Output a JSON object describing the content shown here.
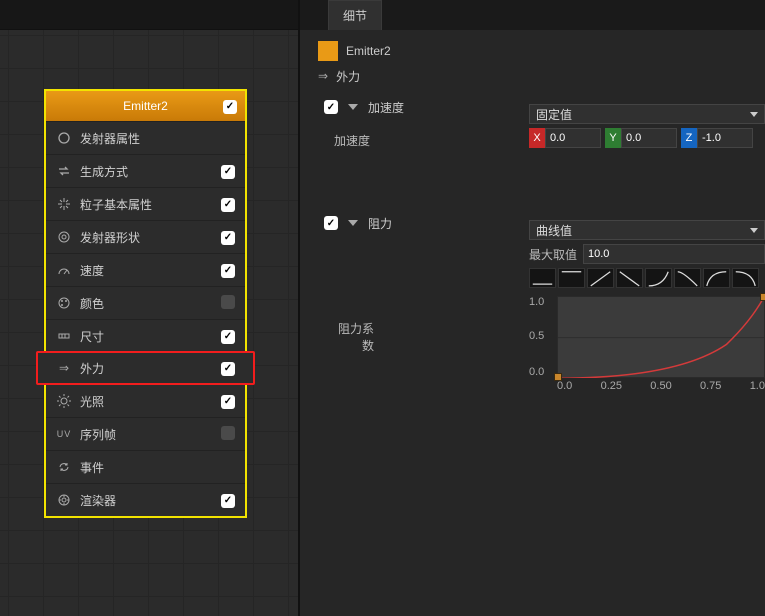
{
  "tab": {
    "title": "细节"
  },
  "crumb": {
    "name": "Emitter2",
    "sub": "外力"
  },
  "module": {
    "title": "Emitter2",
    "items": [
      {
        "label": "发射器属性",
        "icon": "circle",
        "checked": null
      },
      {
        "label": "生成方式",
        "icon": "swap",
        "checked": true
      },
      {
        "label": "粒子基本属性",
        "icon": "spark",
        "checked": true
      },
      {
        "label": "发射器形状",
        "icon": "target",
        "checked": true
      },
      {
        "label": "速度",
        "icon": "gauge",
        "checked": true
      },
      {
        "label": "颜色",
        "icon": "palette",
        "checked": false
      },
      {
        "label": "尺寸",
        "icon": "ruler",
        "checked": true
      },
      {
        "label": "外力",
        "icon": "arrows",
        "checked": true,
        "highlight": true
      },
      {
        "label": "光照",
        "icon": "sun",
        "checked": true
      },
      {
        "label": "序列帧",
        "icon": "uv",
        "checked": false
      },
      {
        "label": "事件",
        "icon": "cycle",
        "checked": null
      },
      {
        "label": "渲染器",
        "icon": "render",
        "checked": true
      }
    ]
  },
  "accel": {
    "heading": "加速度",
    "label": "加速度",
    "mode": "固定值",
    "x": "0.0",
    "y": "0.0",
    "z": "-1.0"
  },
  "drag": {
    "heading": "阻力",
    "label": "阻力系数",
    "mode": "曲线值",
    "maxLabel": "最大取值",
    "maxValue": "10.0",
    "yticks": [
      "1.0",
      "0.5",
      "0.0"
    ],
    "xticks": [
      "0.0",
      "0.25",
      "0.50",
      "0.75",
      "1.0"
    ]
  },
  "chart_data": {
    "type": "line",
    "title": "阻力系数",
    "xlabel": "",
    "ylabel": "",
    "xlim": [
      0.0,
      1.0
    ],
    "ylim": [
      0.0,
      1.0
    ],
    "series": [
      {
        "name": "阻力系数",
        "x": [
          0.0,
          0.25,
          0.5,
          0.75,
          1.0
        ],
        "y": [
          0.0,
          0.05,
          0.22,
          0.52,
          1.0
        ]
      }
    ]
  }
}
